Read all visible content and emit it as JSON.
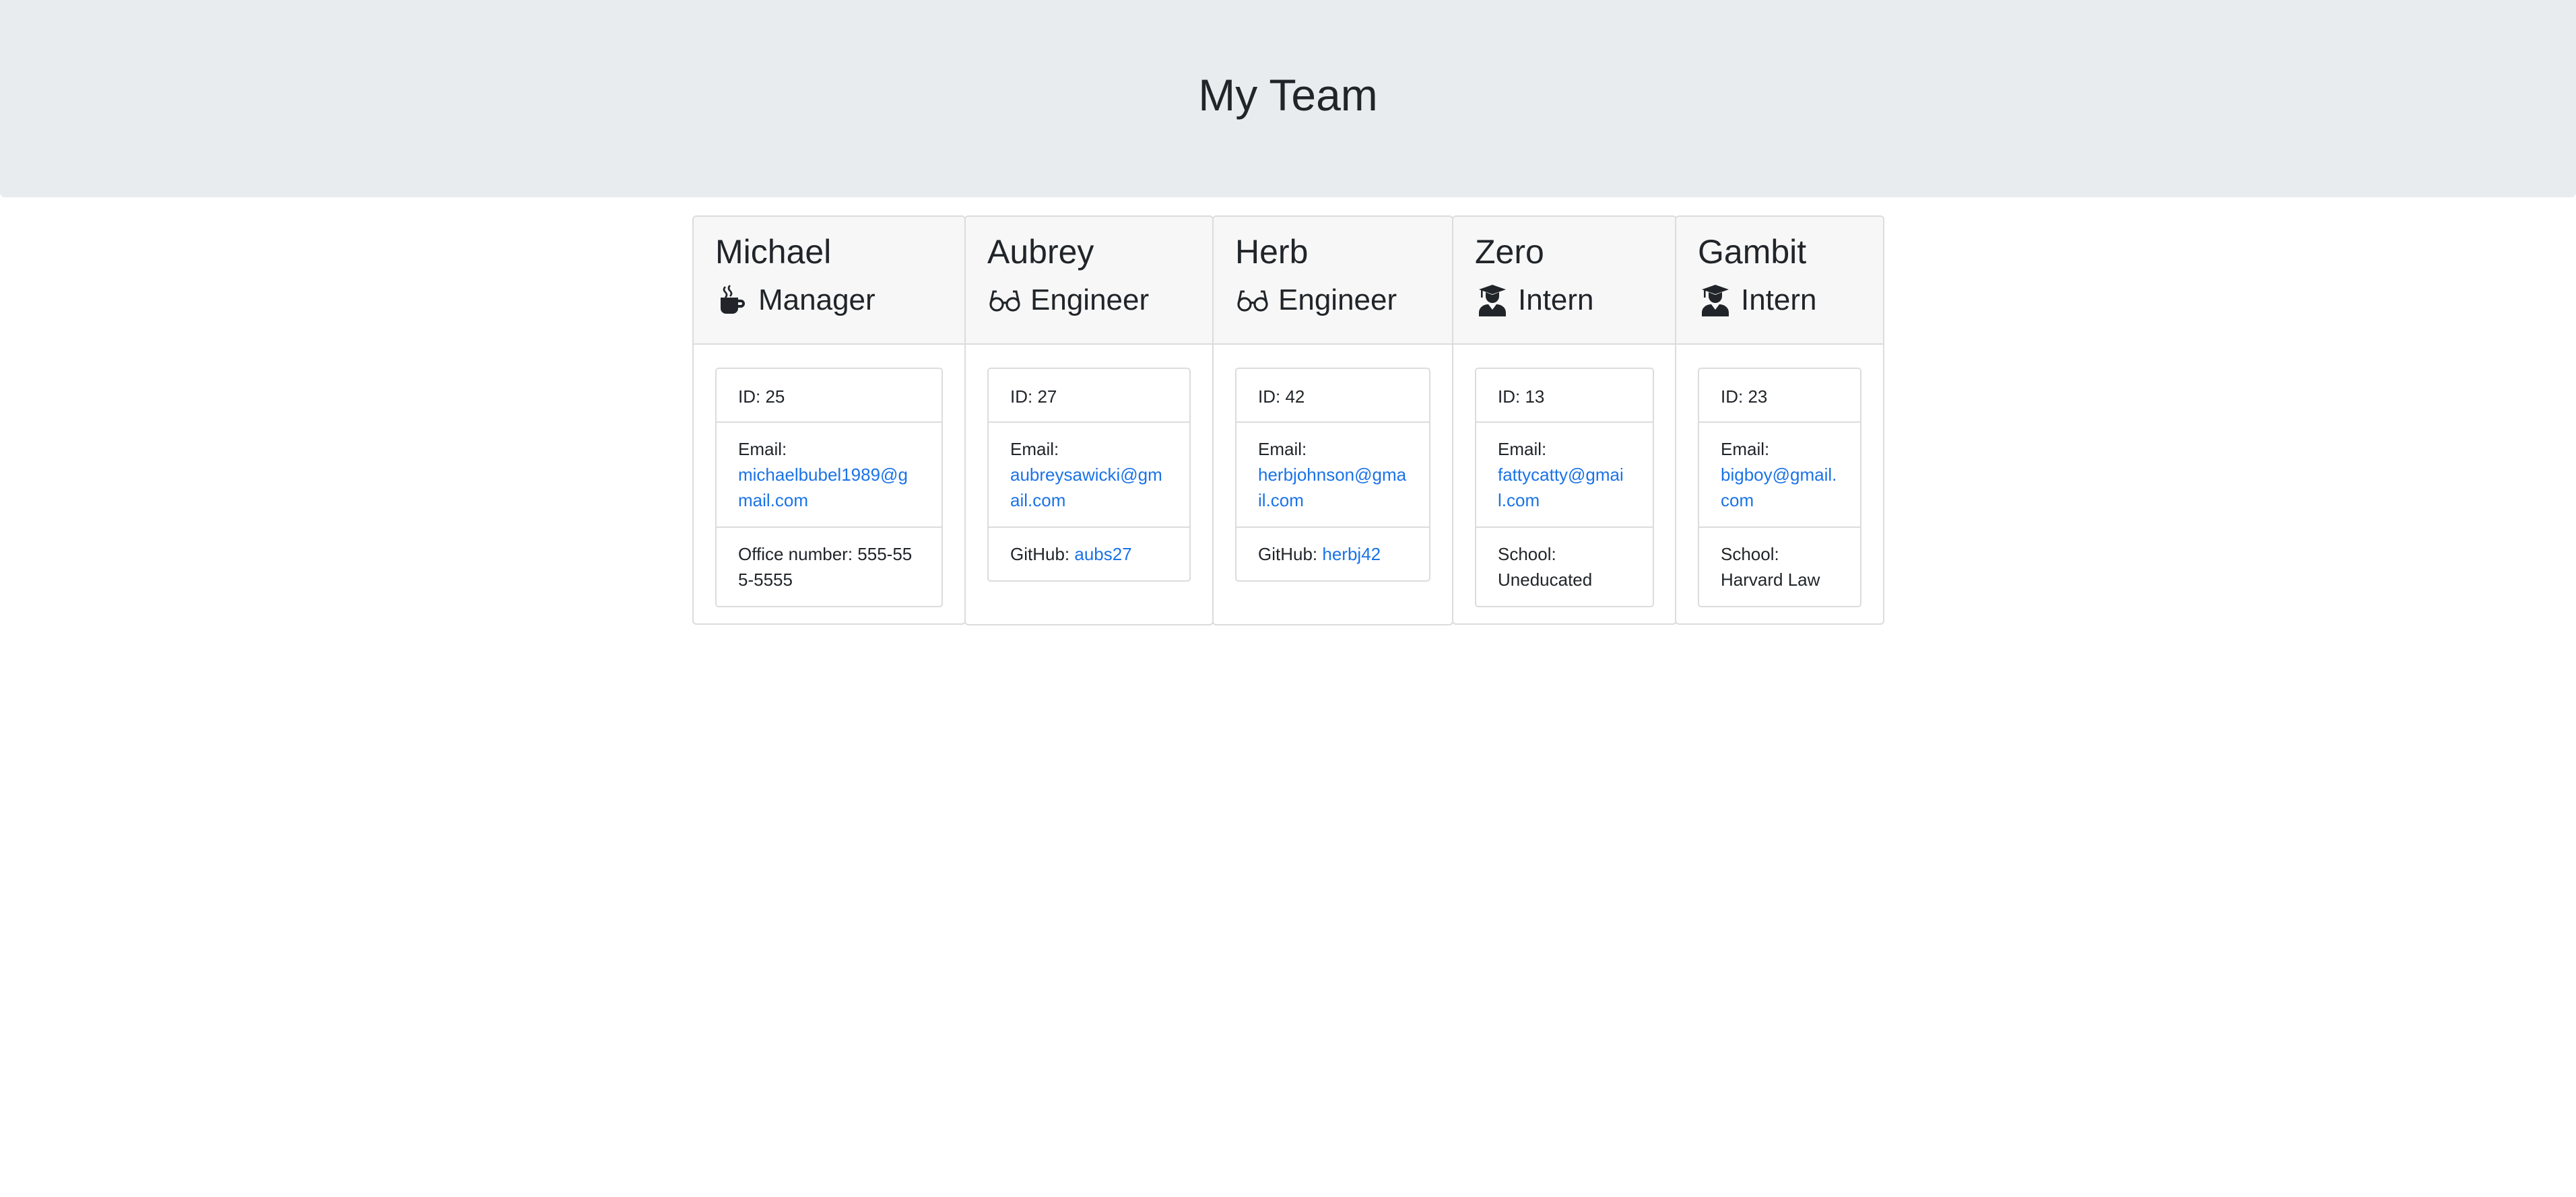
{
  "header": {
    "title": "My Team"
  },
  "cards": [
    {
      "name": "Michael",
      "role": "Manager",
      "icon": "mug-icon",
      "id_label": "ID: 25",
      "email_label": "Email:",
      "email": "michaelbubel1989@gmail.com",
      "extra_label": "Office number:",
      "extra_value": "555-555-5555"
    },
    {
      "name": "Aubrey",
      "role": "Engineer",
      "icon": "glasses-icon",
      "id_label": "ID: 27",
      "email_label": "Email:",
      "email": "aubreysawicki@gmail.com",
      "extra_label": "GitHub:",
      "extra_value": "aubs27"
    },
    {
      "name": "Herb",
      "role": "Engineer",
      "icon": "glasses-icon",
      "id_label": "ID: 42",
      "email_label": "Email:",
      "email": "herbjohnson@gmail.com",
      "extra_label": "GitHub:",
      "extra_value": "herbj42"
    },
    {
      "name": "Zero",
      "role": "Intern",
      "icon": "graduate-icon",
      "id_label": "ID: 13",
      "email_label": "Email:",
      "email": "fattycatty@gmail.com",
      "extra_label": "School:",
      "extra_value": "Uneducated"
    },
    {
      "name": "Gambit",
      "role": "Intern",
      "icon": "graduate-icon",
      "id_label": "ID: 23",
      "email_label": "Email:",
      "email": "bigboy@gmail.com",
      "extra_label": "School:",
      "extra_value": "Harvard Law"
    }
  ],
  "colors": {
    "jumbotron_bg": "#e9ecef",
    "card_header_bg": "#f7f7f7",
    "link": "#1a73e8",
    "text": "#212529"
  }
}
